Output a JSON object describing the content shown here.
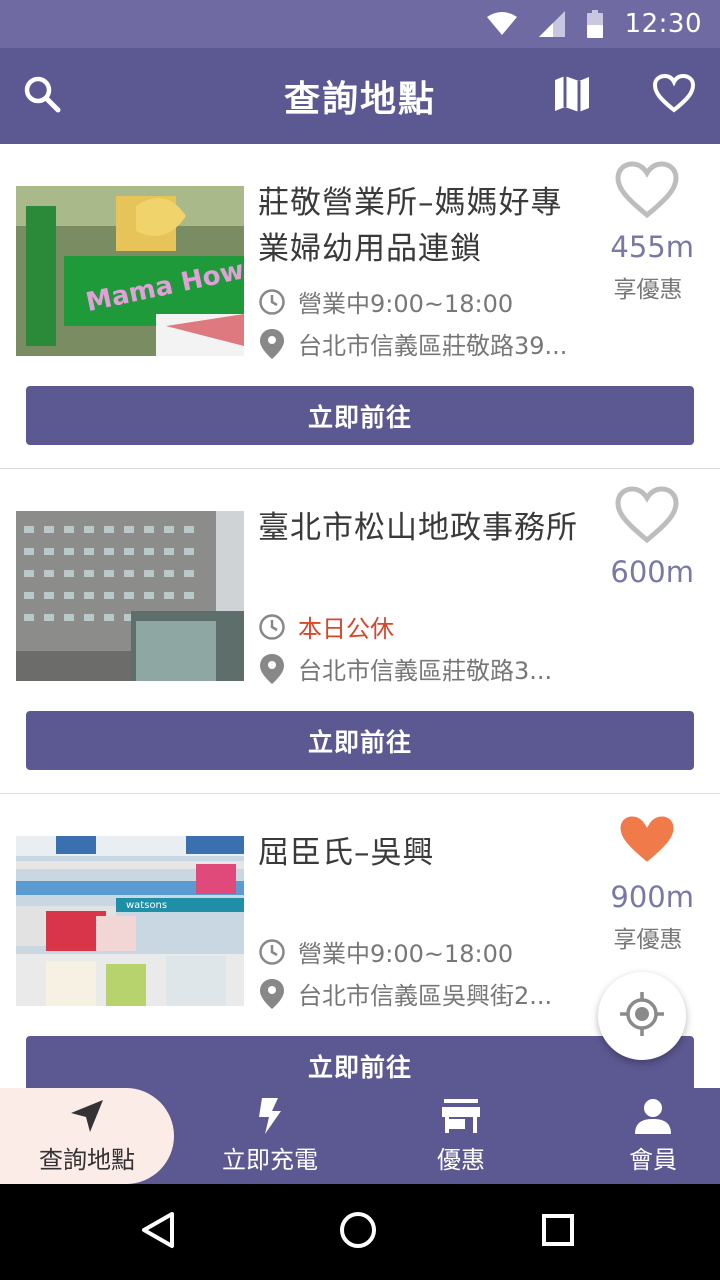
{
  "status": {
    "time": "12:30"
  },
  "appbar": {
    "title": "查詢地點"
  },
  "cards": [
    {
      "name": "莊敬營業所–媽媽好專業婦幼用品連鎖",
      "hours": "營業中9:00~18:00",
      "address": "台北市信義區莊敬路39...",
      "distance": "455m",
      "promo": "享優惠",
      "favorited": false,
      "go_label": "立即前往",
      "thumb_sign": "Mama How!"
    },
    {
      "name": "臺北市松山地政事務所",
      "hours": "本日公休",
      "address": "台北市信義區莊敬路3...",
      "distance": "600m",
      "promo": "",
      "favorited": false,
      "go_label": "立即前往"
    },
    {
      "name": "屈臣氏–吳興",
      "hours": "營業中9:00~18:00",
      "address": "台北市信義區吳興街2...",
      "distance": "900m",
      "promo": "享優惠",
      "favorited": true,
      "go_label": "立即前往",
      "thumb_sign": "watsons"
    }
  ],
  "bottomnav": [
    {
      "label": "查詢地點",
      "icon": "navigation-arrow-icon",
      "active": true
    },
    {
      "label": "立即充電",
      "icon": "lightning-icon",
      "active": false
    },
    {
      "label": "優惠",
      "icon": "store-icon",
      "active": false
    },
    {
      "label": "會員",
      "icon": "person-icon",
      "active": false
    }
  ],
  "colors": {
    "primary": "#5c5892",
    "statusbar": "#6f6aa2",
    "closed": "#d5482c",
    "favorite": "#f07a4a",
    "active_tab": "#fbece8"
  }
}
